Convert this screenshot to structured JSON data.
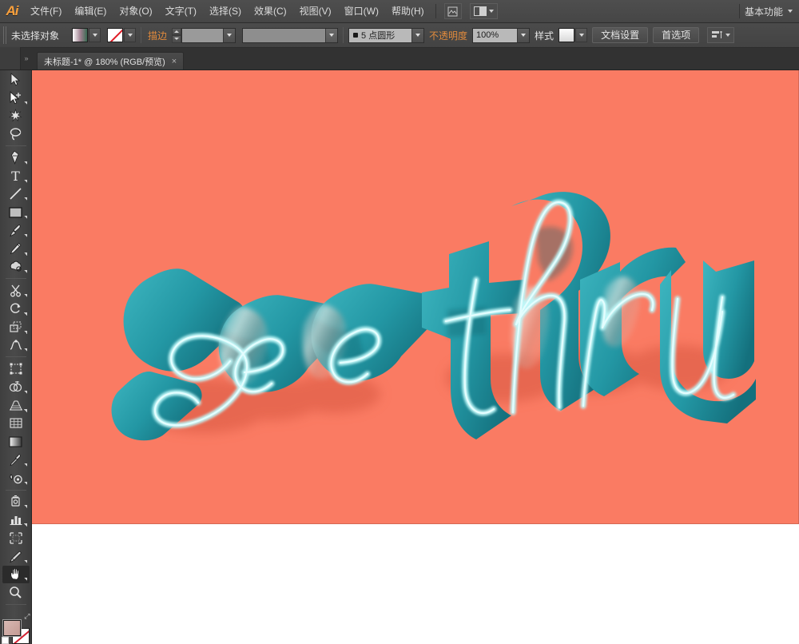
{
  "app": {
    "name": "Adobe Illustrator",
    "logo_text": "Ai"
  },
  "menubar": {
    "items": [
      {
        "label": "文件(F)",
        "name": "menu-file"
      },
      {
        "label": "编辑(E)",
        "name": "menu-edit"
      },
      {
        "label": "对象(O)",
        "name": "menu-object"
      },
      {
        "label": "文字(T)",
        "name": "menu-type"
      },
      {
        "label": "选择(S)",
        "name": "menu-select"
      },
      {
        "label": "效果(C)",
        "name": "menu-effect"
      },
      {
        "label": "视图(V)",
        "name": "menu-view"
      },
      {
        "label": "窗口(W)",
        "name": "menu-window"
      },
      {
        "label": "帮助(H)",
        "name": "menu-help"
      }
    ],
    "bridge_icon": "bridge-icon",
    "arrange_documents_icon": "arrange-documents-icon",
    "workspace": "基本功能"
  },
  "controlbar": {
    "selection_label": "未选择对象",
    "fill_swatch": "fill-gradient-swatch",
    "stroke_swatch": "stroke-none-swatch",
    "stroke_label": "描边",
    "stroke_weight_value": "",
    "stroke_profile_value": "",
    "brush_value": "5 点圆形",
    "opacity_label": "不透明度",
    "opacity_value": "100%",
    "style_label": "样式",
    "document_setup_label": "文档设置",
    "preferences_label": "首选项",
    "extra_icon": "align-options-icon"
  },
  "tabbar": {
    "document_title": "未标题-1* @ 180% (RGB/预览)",
    "close_glyph": "×"
  },
  "toolbar": {
    "tools": [
      {
        "name": "selection-tool",
        "icon": "arrow-icon",
        "has_flyout": false
      },
      {
        "name": "direct-selection-tool",
        "icon": "white-arrow-plus-icon",
        "has_flyout": true
      },
      {
        "name": "magic-wand-tool",
        "icon": "magic-wand-icon",
        "has_flyout": false
      },
      {
        "name": "lasso-tool",
        "icon": "lasso-icon",
        "has_flyout": false
      },
      {
        "name": "pen-tool",
        "icon": "pen-icon",
        "has_flyout": true
      },
      {
        "name": "type-tool",
        "icon": "type-t-icon",
        "has_flyout": true
      },
      {
        "name": "line-segment-tool",
        "icon": "line-icon",
        "has_flyout": true
      },
      {
        "name": "rectangle-tool",
        "icon": "rectangle-icon",
        "has_flyout": true
      },
      {
        "name": "paintbrush-tool",
        "icon": "paintbrush-icon",
        "has_flyout": true
      },
      {
        "name": "pencil-tool",
        "icon": "pencil-icon",
        "has_flyout": true
      },
      {
        "name": "blob-brush-tool",
        "icon": "blob-brush-icon",
        "has_flyout": true
      },
      {
        "name": "scissors-tool",
        "icon": "scissors-icon",
        "has_flyout": true
      },
      {
        "name": "rotate-tool",
        "icon": "rotate-icon",
        "has_flyout": true
      },
      {
        "name": "scale-tool",
        "icon": "scale-icon",
        "has_flyout": true
      },
      {
        "name": "width-tool",
        "icon": "warp-icon",
        "has_flyout": true
      },
      {
        "name": "free-transform-tool",
        "icon": "free-transform-icon",
        "has_flyout": false
      },
      {
        "name": "shape-builder-tool",
        "icon": "shape-builder-icon",
        "has_flyout": true
      },
      {
        "name": "perspective-grid-tool",
        "icon": "perspective-grid-icon",
        "has_flyout": true
      },
      {
        "name": "mesh-tool",
        "icon": "mesh-icon",
        "has_flyout": false
      },
      {
        "name": "gradient-tool",
        "icon": "gradient-icon",
        "has_flyout": false
      },
      {
        "name": "eyedropper-tool",
        "icon": "eyedropper-icon",
        "has_flyout": true
      },
      {
        "name": "blend-tool",
        "icon": "blend-icon",
        "has_flyout": true
      },
      {
        "name": "symbol-sprayer-tool",
        "icon": "symbol-sprayer-icon",
        "has_flyout": true
      },
      {
        "name": "column-graph-tool",
        "icon": "bar-graph-icon",
        "has_flyout": true
      },
      {
        "name": "artboard-tool",
        "icon": "artboard-icon",
        "has_flyout": false
      },
      {
        "name": "slice-tool",
        "icon": "slice-knife-icon",
        "has_flyout": true
      },
      {
        "name": "hand-tool",
        "icon": "hand-icon",
        "has_flyout": true,
        "active": true
      },
      {
        "name": "zoom-tool",
        "icon": "magnifier-icon",
        "has_flyout": false
      }
    ],
    "fill_swatch": "fill-color-swatch",
    "stroke_swatch": "stroke-none-swatch",
    "swap_icon": "swap-fill-stroke-icon",
    "default_icon": "default-fill-stroke-icon"
  },
  "artwork": {
    "background_color": "#FA7B63",
    "text_words": [
      "see",
      "thru"
    ],
    "letter_face_color": "#2EA8B4",
    "letter_extrude_color": "#1C7F8C",
    "letter_outline_color": "#BFF6F7",
    "shadow_color": "#E86A53",
    "highlight_color": "#F2E9E4",
    "zoom_level": "180%",
    "color_mode": "RGB",
    "view_mode": "预览"
  },
  "colors": {
    "chrome_dark": "#3a3a3a",
    "chrome_mid": "#4a4a4a",
    "accent_orange": "#e08a3c",
    "canvas_white": "#ffffff"
  }
}
